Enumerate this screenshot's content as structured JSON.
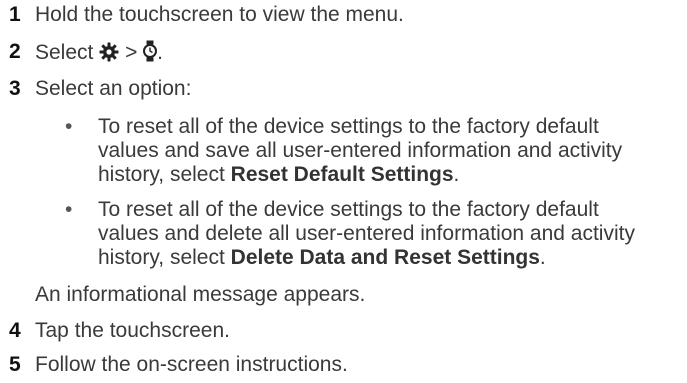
{
  "steps": [
    {
      "num": "1",
      "text": "Hold the touchscreen to view the menu."
    },
    {
      "num": "2",
      "text_before": "Select",
      "sep": ">",
      "text_after": "."
    },
    {
      "num": "3",
      "text": "Select an option:"
    },
    {
      "num": "4",
      "text": "Tap the touchscreen."
    },
    {
      "num": "5",
      "text": "Follow the on-screen instructions."
    }
  ],
  "options": [
    {
      "lines": [
        "To reset all of the device settings to the factory default",
        "values and save all user-entered information and activity"
      ],
      "last_prefix": "history, select ",
      "bold": "Reset Default Settings",
      "suffix": "."
    },
    {
      "lines": [
        "To reset all of the device settings to the factory default",
        "values and delete all user-entered information and activity"
      ],
      "last_prefix": "history, select ",
      "bold": "Delete Data and Reset Settings",
      "suffix": "."
    }
  ],
  "bullet_char": "•",
  "note": "An informational message appears.",
  "icons": [
    "gear-icon",
    "watch-icon"
  ]
}
